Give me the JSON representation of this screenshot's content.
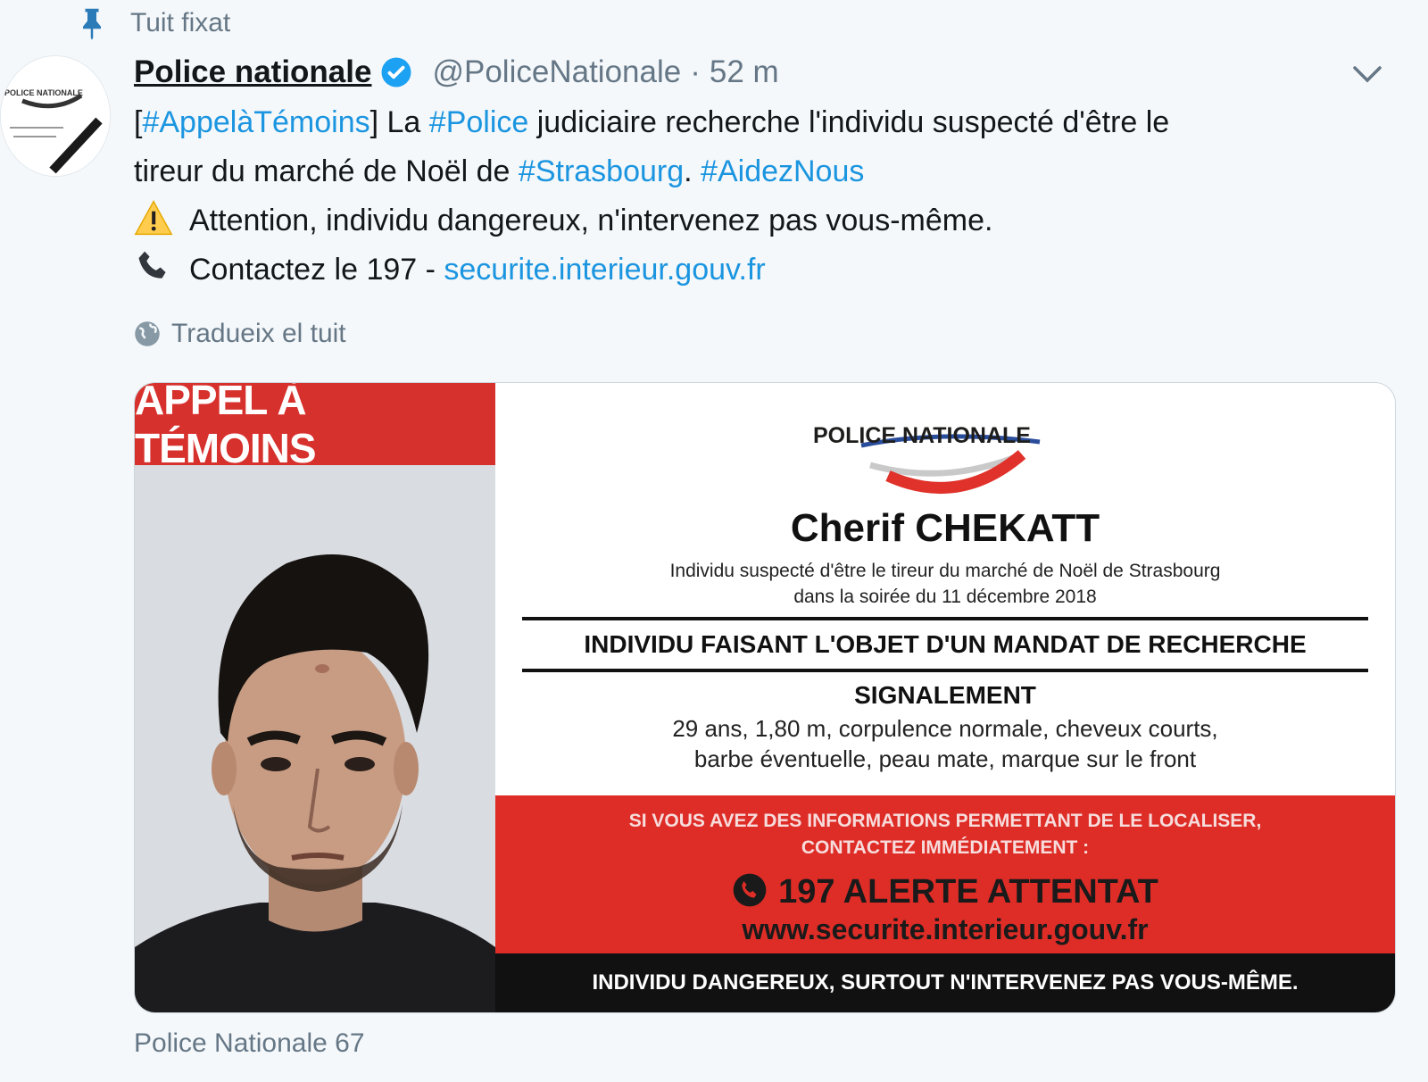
{
  "pinned": {
    "label": "Tuit fixat",
    "icon": "pin-icon"
  },
  "tweet": {
    "display_name": "Police nationale",
    "handle": "@PoliceNationale",
    "separator": "·",
    "time": "52 m",
    "verified_icon": "verified-badge-icon",
    "text": {
      "line1": {
        "part1": "[",
        "tag1": "#AppelàTémoins",
        "part2": "] La ",
        "tag2": "#Police",
        "part3": " judiciaire recherche l'individu suspecté d'être le"
      },
      "line2": {
        "part1": "tireur du marché de Noël de ",
        "tag1": "#Strasbourg",
        "part2": ". ",
        "tag2": "#AidezNous"
      },
      "line3": {
        "emoji": "warning-emoji",
        "text": "Attention, individu dangereux, n'intervenez pas vous-même."
      },
      "line4": {
        "emoji": "telephone-emoji",
        "text": "Contactez le 197 - ",
        "link": "securite.interieur.gouv.fr"
      }
    },
    "translate_label": "Tradueix el tuit",
    "source": "Police Nationale 67"
  },
  "poster": {
    "banner": "APPEL À TÉMOINS",
    "logo_text": "POLICE NATIONALE",
    "name": "Cherif CHEKATT",
    "desc_line1": "Individu suspecté d'être le tireur du marché de Noël de Strasbourg",
    "desc_line2": "dans la soirée du 11 décembre 2018",
    "mandat": "INDIVIDU FAISANT L'OBJET D'UN MANDAT DE RECHERCHE",
    "signalement_title": "SIGNALEMENT",
    "signalement_line1": "29 ans, 1,80 m, corpulence normale, cheveux courts,",
    "signalement_line2": "barbe éventuelle, peau mate, marque sur le front",
    "info_line1": "SI VOUS AVEZ DES INFORMATIONS PERMETTANT DE LE LOCALISER,",
    "info_line2": "CONTACTEZ IMMÉDIATEMENT :",
    "alert": "197 ALERTE ATTENTAT",
    "website": "www.securite.interieur.gouv.fr",
    "warning": "INDIVIDU DANGEREUX, SURTOUT N'INTERVENEZ PAS VOUS-MÊME."
  },
  "colors": {
    "link": "#1b95e0",
    "poster_red": "#de2d27",
    "verified": "#1da1f2"
  }
}
